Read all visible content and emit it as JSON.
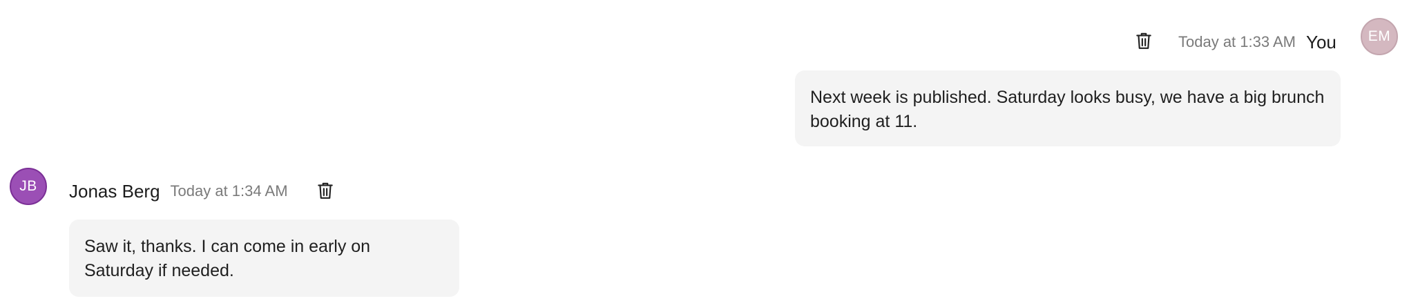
{
  "messages": [
    {
      "author": "You",
      "avatar_initials": "EM",
      "avatar_color": "#d4b8c0",
      "timestamp": "Today at 1:33 AM",
      "text": "Next week is published. Saturday looks busy, we have a big brunch booking at 11.",
      "delete_icon": "trash-icon",
      "own": true
    },
    {
      "author": "Jonas Berg",
      "avatar_initials": "JB",
      "avatar_color": "#9b4fb5",
      "timestamp": "Today at 1:34 AM",
      "text": "Saw it, thanks. I can come in early on Saturday if needed.",
      "delete_icon": "trash-icon",
      "own": false
    }
  ]
}
